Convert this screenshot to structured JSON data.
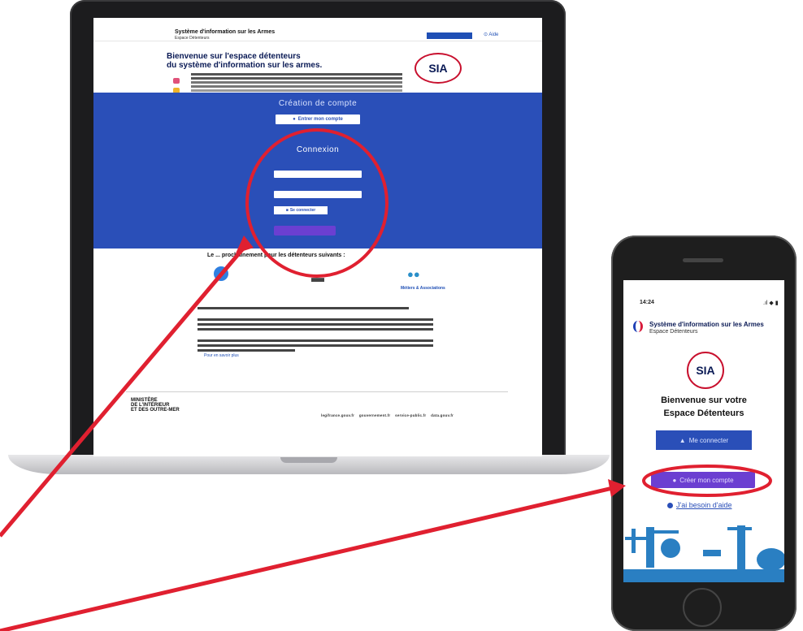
{
  "laptop_site": {
    "header": {
      "title": "Système d'information sur les Armes",
      "subtitle": "Espace Détenteurs",
      "help_link": "Aide"
    },
    "welcome": {
      "line1": "Bienvenue sur l'espace détenteurs",
      "line2": "du système d'information sur les armes."
    },
    "logo_text": "SIA",
    "creation": {
      "heading": "Création de compte",
      "button": "Entrer mon compte"
    },
    "connexion": {
      "heading": "Connexion",
      "button": "Se connecter"
    },
    "upcoming_heading": "Le ... prochainement pour les détenteurs suivants :",
    "categories": [
      "Métiers & Associations"
    ],
    "footer": {
      "ministere": [
        "MINISTÈRE",
        "DE L'INTÉRIEUR",
        "ET DES OUTRE-MER"
      ],
      "links": [
        "legifrance.gouv.fr",
        "gouvernement.fr",
        "service-public.fr",
        "data.gouv.fr"
      ],
      "more_link": "Pour en savoir plus"
    }
  },
  "phone_app": {
    "status": {
      "time": "14:24"
    },
    "header": {
      "title": "Système d'information sur les Armes",
      "subtitle": "Espace Détenteurs"
    },
    "logo_text": "SIA",
    "welcome": {
      "line1": "Bienvenue sur votre",
      "line2": "Espace Détenteurs"
    },
    "buttons": {
      "connect": "Me connecter",
      "create": "Créer mon compte",
      "help": "J'ai besoin d'aide"
    }
  },
  "colors": {
    "brand_blue": "#2a4fb8",
    "franceconnect_purple": "#6b3fd1",
    "annotation_red": "#e02030",
    "logo_red": "#c8102e"
  },
  "icons": [
    "user-icon",
    "arrow-icon",
    "help-icon",
    "signal-icon"
  ]
}
